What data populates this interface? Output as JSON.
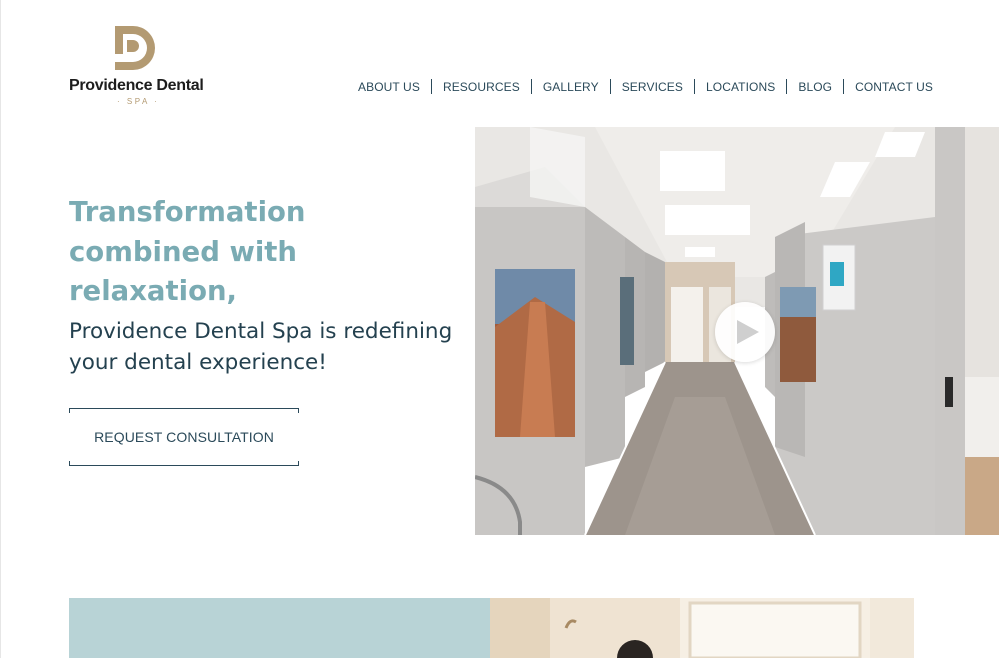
{
  "brand": {
    "name": "Providence Dental",
    "sub": "· SPA ·",
    "gold": "#b39a72"
  },
  "nav": {
    "items": [
      {
        "label": "ABOUT US"
      },
      {
        "label": "RESOURCES"
      },
      {
        "label": "GALLERY"
      },
      {
        "label": "SERVICES"
      },
      {
        "label": "LOCATIONS"
      },
      {
        "label": "BLOG"
      },
      {
        "label": "CONTACT US"
      }
    ]
  },
  "hero": {
    "headline_line1": "Transformation",
    "headline_line2": "combined with",
    "headline_line3": "relaxation,",
    "subhead_line1": "Providence Dental Spa is redefining",
    "subhead_line2": "your dental experience!",
    "cta_label": "REQUEST CONSULTATION",
    "image_icon": "play-icon"
  },
  "colors": {
    "accent_teal": "#7aabb3",
    "navy_text": "#24414f",
    "panel_blue": "#b8d3d6"
  }
}
